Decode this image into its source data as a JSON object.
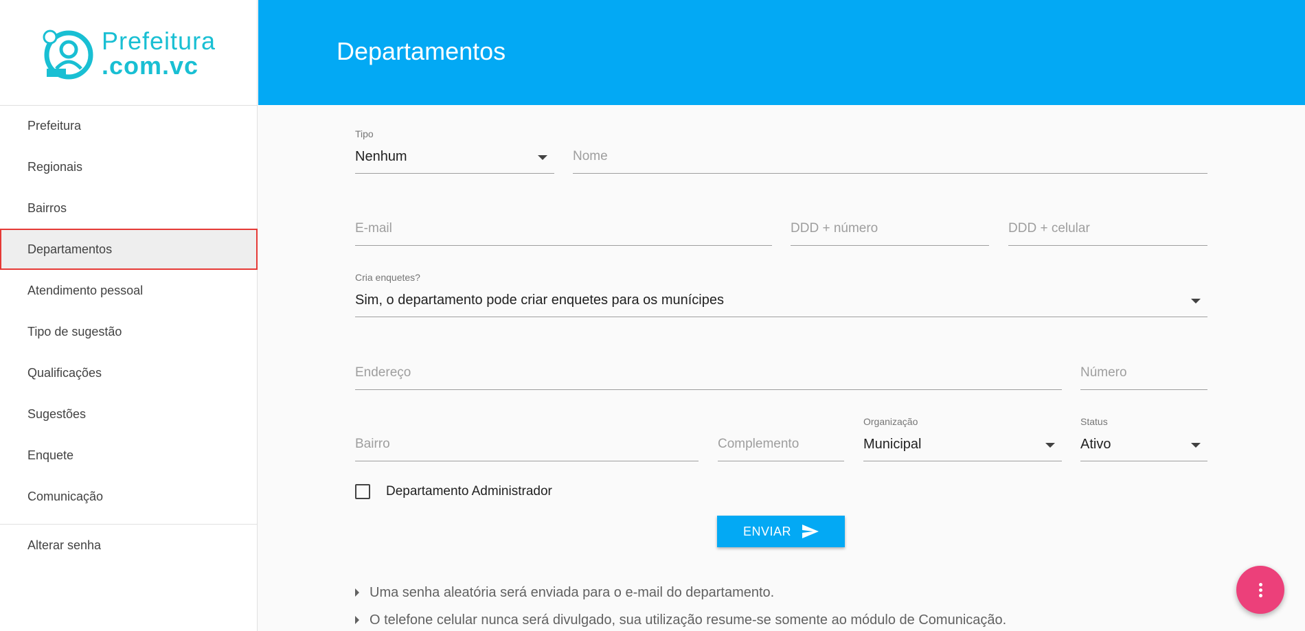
{
  "brand": {
    "line1": "Prefeitura",
    "line2": ".com.vc",
    "color": "#19bfd3"
  },
  "header": {
    "title": "Departamentos",
    "color": "#03a9f4"
  },
  "sidebar": {
    "items": [
      {
        "label": "Prefeitura"
      },
      {
        "label": "Regionais"
      },
      {
        "label": "Bairros"
      },
      {
        "label": "Departamentos",
        "active": true
      },
      {
        "label": "Atendimento pessoal"
      },
      {
        "label": "Tipo de sugestão"
      },
      {
        "label": "Qualificações"
      },
      {
        "label": "Sugestões"
      },
      {
        "label": "Enquete"
      },
      {
        "label": "Comunicação"
      }
    ],
    "bottom": [
      {
        "label": "Alterar senha"
      }
    ]
  },
  "form": {
    "tipo": {
      "label": "Tipo",
      "value": "Nenhum"
    },
    "nome": {
      "placeholder": "Nome"
    },
    "email": {
      "placeholder": "E-mail"
    },
    "telefone": {
      "placeholder": "DDD + número"
    },
    "celular": {
      "placeholder": "DDD + celular"
    },
    "enquetes": {
      "label": "Cria enquetes?",
      "value": "Sim, o departamento pode criar enquetes para os munícipes"
    },
    "endereco": {
      "placeholder": "Endereço"
    },
    "numero": {
      "placeholder": "Número"
    },
    "bairro": {
      "placeholder": "Bairro"
    },
    "complemento": {
      "placeholder": "Complemento"
    },
    "organizacao": {
      "label": "Organização",
      "value": "Municipal"
    },
    "status": {
      "label": "Status",
      "value": "Ativo"
    },
    "admin_checkbox": {
      "label": "Departamento Administrador",
      "checked": false
    },
    "submit_label": "ENVIAR"
  },
  "notes": [
    "Uma senha aleatória será enviada para o e-mail do departamento.",
    "O telefone celular nunca será divulgado, sua utilização resume-se somente ao módulo de Comunicação."
  ],
  "fab": {
    "icon": "more-vert-icon",
    "color": "#ec407a"
  }
}
